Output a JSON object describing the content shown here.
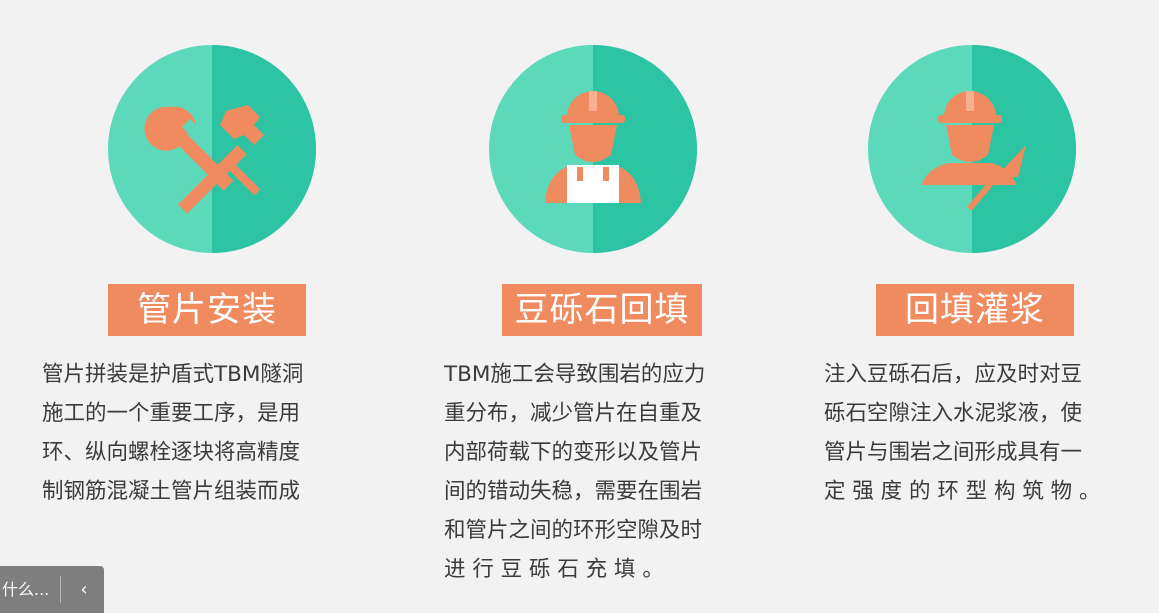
{
  "cards": [
    {
      "title": "管片安装",
      "description": "管片拼装是护盾式TBM隧洞\n施工的一个重要工序，是用\n环、纵向螺栓逐块将高精度\n制钢筋混凝土管片组装而成",
      "icon": "wrench-hammer-icon"
    },
    {
      "title": "豆砾石回填",
      "description": "TBM施工会导致围岩的应力\n重分布，减少管片在自重及\n内部荷载下的变形以及管片\n间的错动失稳，需要在围岩\n和管片之间的环形空隙及时\n进 行 豆 砾 石 充 填 。",
      "icon": "worker-helmet-icon"
    },
    {
      "title": "回填灌浆",
      "description": "注入豆砾石后，应及时对豆\n砾石空隙注入水泥浆液，使\n管片与围岩之间形成具有一\n定 强 度 的 环 型 构 筑 物 。",
      "icon": "worker-trowel-icon"
    }
  ],
  "toast": {
    "text": "什么...",
    "chevron": "‹"
  },
  "colors": {
    "background": "#f2f2f2",
    "circle_light": "#5cd9bb",
    "circle_dark": "#2dc4a3",
    "accent": "#ef8b5f"
  }
}
